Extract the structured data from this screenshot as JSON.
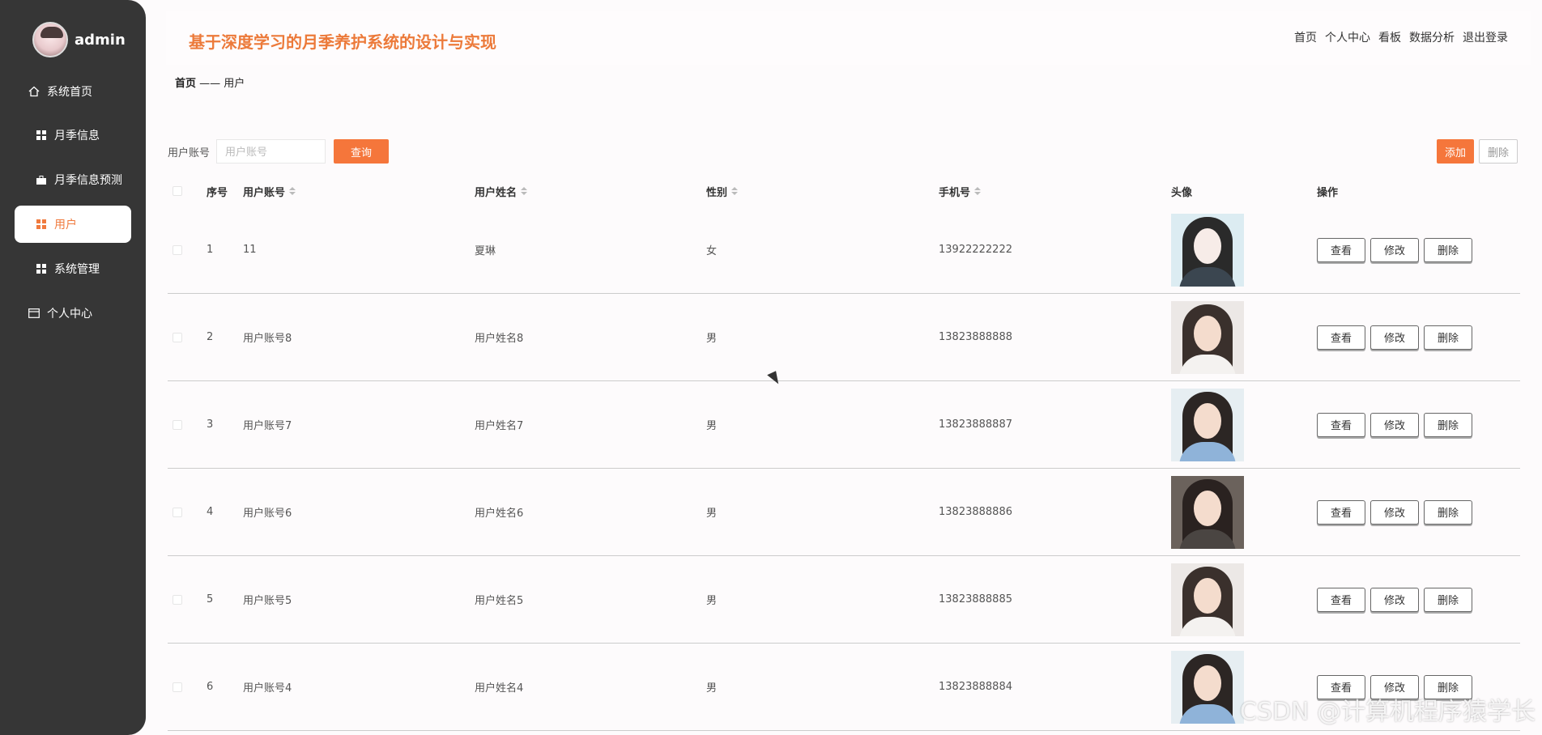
{
  "sidebar": {
    "profile": {
      "name": "admin"
    },
    "items": [
      {
        "label": "系统首页"
      },
      {
        "label": "月季信息"
      },
      {
        "label": "月季信息预测"
      },
      {
        "label": "用户"
      },
      {
        "label": "系统管理"
      },
      {
        "label": "个人中心"
      }
    ]
  },
  "header": {
    "title": "基于深度学习的月季养护系统的设计与实现",
    "nav": [
      "首页",
      "个人中心",
      "看板",
      "数据分析",
      "退出登录"
    ]
  },
  "breadcrumb": {
    "home": "首页",
    "sep": "——",
    "current": "用户"
  },
  "search": {
    "label": "用户账号",
    "placeholder": "用户账号",
    "button": "查询"
  },
  "actions": {
    "add": "添加",
    "delete": "删除"
  },
  "table": {
    "columns": [
      "序号",
      "用户账号",
      "用户姓名",
      "性别",
      "手机号",
      "头像",
      "操作"
    ],
    "rows": [
      {
        "idx": "1",
        "account": "11",
        "name": "夏琳",
        "gender": "女",
        "phone": "13922222222"
      },
      {
        "idx": "2",
        "account": "用户账号8",
        "name": "用户姓名8",
        "gender": "男",
        "phone": "13823888888"
      },
      {
        "idx": "3",
        "account": "用户账号7",
        "name": "用户姓名7",
        "gender": "男",
        "phone": "13823888887"
      },
      {
        "idx": "4",
        "account": "用户账号6",
        "name": "用户姓名6",
        "gender": "男",
        "phone": "13823888886"
      },
      {
        "idx": "5",
        "account": "用户账号5",
        "name": "用户姓名5",
        "gender": "男",
        "phone": "13823888885"
      },
      {
        "idx": "6",
        "account": "用户账号4",
        "name": "用户姓名4",
        "gender": "男",
        "phone": "13823888884"
      }
    ],
    "row_actions": {
      "view": "查看",
      "edit": "修改",
      "delete": "删除"
    }
  },
  "watermark": "CSDN @计算机程序猿学长",
  "colors": {
    "accent": "#f5763b",
    "sidebar": "#363636",
    "title": "#ec7a3a"
  }
}
